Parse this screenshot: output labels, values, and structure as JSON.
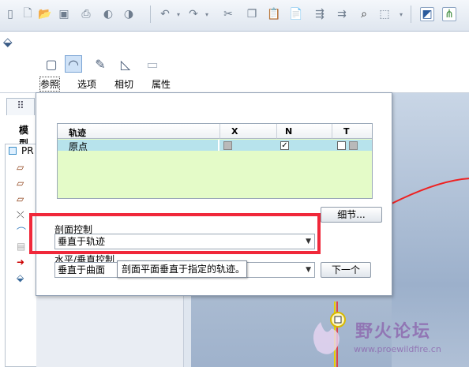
{
  "toolbar": {
    "icons": [
      "new-file-icon",
      "open-icon",
      "save-icon",
      "print-icon",
      "connect-icon",
      "disconnect-icon",
      "undo-icon",
      "redo-icon",
      "cut-icon",
      "copy-icon",
      "paste-icon",
      "paste-special-icon",
      "regenerate-icon",
      "regen-manager-icon",
      "find-icon",
      "select-box-icon",
      "display-style-icon",
      "datum-display-icon"
    ]
  },
  "ribbon": {
    "tabs": [
      {
        "label": "参照",
        "selected": true
      },
      {
        "label": "选项",
        "selected": false
      },
      {
        "label": "相切",
        "selected": false
      },
      {
        "label": "属性",
        "selected": false
      }
    ]
  },
  "left_panel": {
    "header": "模型",
    "root_label": "PR"
  },
  "dialog": {
    "table": {
      "headers": [
        "轨迹",
        "X",
        "N",
        "T"
      ],
      "rows": [
        {
          "name": "原点",
          "x_checked": false,
          "n_checked": true,
          "t_checked": false
        }
      ]
    },
    "details_button": "细节...",
    "section_control_label": "剖面控制",
    "section_control_value": "垂直于轨迹",
    "hv_control_label": "水平/垂直控制",
    "hv_control_value": "垂直于曲面",
    "next_button": "下一个",
    "tooltip": "剖面平面垂直于指定的轨迹。"
  },
  "watermark": {
    "text": "野火论坛",
    "url": "www.proewildfire.cn"
  },
  "colors": {
    "highlight": "#f0283a",
    "table_bg": "#e4fbc8",
    "selected_row": "#b7e3ec"
  }
}
